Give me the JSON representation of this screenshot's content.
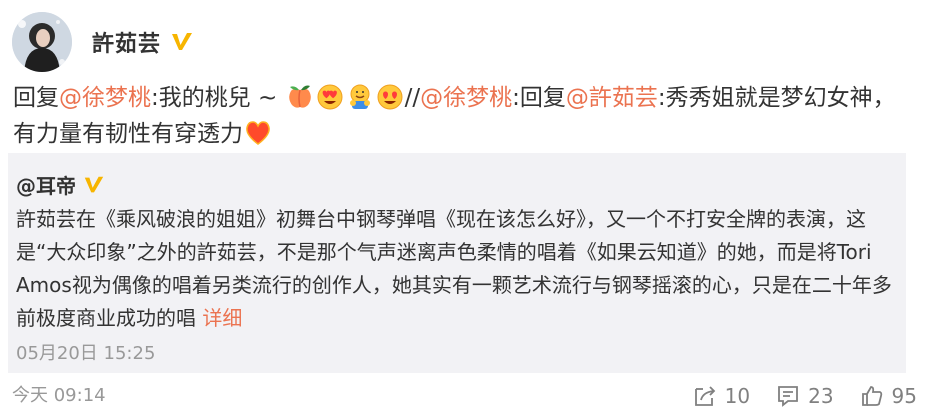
{
  "user": {
    "name": "許茹芸"
  },
  "main_post": {
    "reply1": "回复",
    "mention1": "@徐梦桃",
    "text1": ":我的桃兒 ~ ",
    "sep": "//",
    "mention2": "@徐梦桃",
    "reply2": ":回复",
    "mention3": "@許茹芸",
    "text2": ":秀秀姐就是梦幻女神，有力量有韧性有穿透力"
  },
  "quoted": {
    "author": "@耳帝",
    "text": "許茹芸在《乘风破浪的姐姐》初舞台中钢琴弹唱《现在该怎么好》，又一个不打安全牌的表演，这是“大众印象”之外的許茹芸，不是那个气声迷离声色柔情的唱着《如果云知道》的她，而是将Tori Amos视为偶像的唱着另类流行的创作人，她其实有一颗艺术流行与钢琴摇滚的心，只是在二十年多前极度商业成功的唱 ",
    "more": "详细",
    "time": "05月20日 15:25"
  },
  "footer": {
    "time": "今天 09:14",
    "repost_count": "10",
    "comment_count": "23",
    "like_count": "95"
  },
  "icons": [
    "verified-v-icon",
    "peach-emoji",
    "heart-eyes-emoji",
    "hug-emoji",
    "heart-emoji",
    "share-icon",
    "comment-icon",
    "like-icon"
  ],
  "colors": {
    "accent": "#eb7350",
    "verified": "#f7b500",
    "muted": "#999999",
    "quote_bg": "#f2f2f5"
  }
}
